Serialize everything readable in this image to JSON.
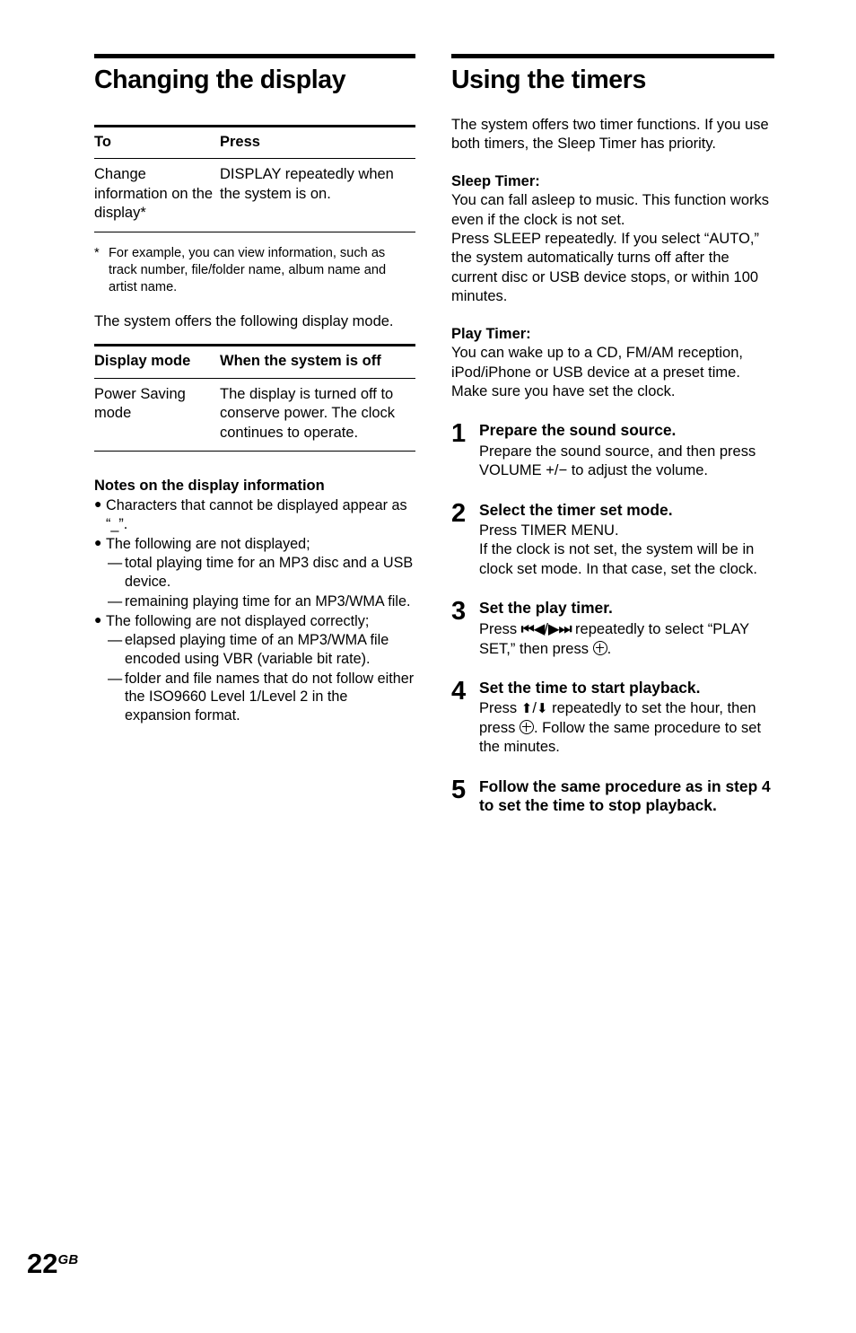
{
  "page": {
    "number": "22",
    "region_code": "GB"
  },
  "left_column": {
    "title": "Changing the display",
    "table1": {
      "headers": [
        "To",
        "Press"
      ],
      "rows": [
        {
          "to": "Change information on the display*",
          "press": "DISPLAY repeatedly when the system is on."
        }
      ]
    },
    "footnote": {
      "mark": "*",
      "text": "For example, you can view information, such as track number, file/folder name, album name and artist name."
    },
    "intro": "The system offers the following display mode.",
    "table2": {
      "headers": [
        "Display mode",
        "When the system is off"
      ],
      "rows": [
        {
          "mode": "Power Saving mode",
          "when_off": "The display is turned off to conserve power. The clock continues to operate."
        }
      ]
    },
    "notes": {
      "title": "Notes on the display information",
      "items": [
        {
          "text": "Characters that cannot be displayed appear as “_”.",
          "sub": []
        },
        {
          "text": "The following are not displayed;",
          "sub": [
            "total playing time for an MP3 disc and a USB device.",
            "remaining playing time for an MP3/WMA file."
          ]
        },
        {
          "text": "The following are not displayed correctly;",
          "sub": [
            "elapsed playing time of an MP3/WMA file encoded using VBR (variable bit rate).",
            "folder and file names that do not follow either the ISO9660 Level 1/Level 2 in the expansion format."
          ]
        }
      ]
    }
  },
  "right_column": {
    "title": "Using the timers",
    "intro": "The system offers two timer functions. If you use both timers, the Sleep Timer has priority.",
    "sleep_timer": {
      "heading": "Sleep Timer:",
      "text_1": "You can fall asleep to music. This function works even if the clock is not set.",
      "text_2": "Press SLEEP repeatedly. If you select “AUTO,” the system automatically turns off after the current disc or USB device stops, or within 100 minutes."
    },
    "play_timer": {
      "heading": "Play Timer:",
      "text_1": "You can wake up to a CD, FM/AM reception, iPod/iPhone or USB device at a preset time.",
      "text_2": "Make sure you have set the clock."
    },
    "steps": [
      {
        "number": "1",
        "title": "Prepare the sound source.",
        "text_a": "Prepare the sound source, and then press VOLUME +/− to adjust the volume.",
        "text_b": "",
        "text_c": ""
      },
      {
        "number": "2",
        "title": "Select the timer set mode.",
        "text_a": "Press TIMER MENU.",
        "text_b": "If the clock is not set, the system will be in clock set mode. In that case, set the clock.",
        "text_c": ""
      },
      {
        "number": "3",
        "title": "Set the play timer.",
        "text_a": "Press ",
        "text_b": " repeatedly to select “PLAY SET,” then press ",
        "text_c": ".",
        "glyph_prev": "⏮◀",
        "glyph_sep": "/",
        "glyph_next": "▶⏭"
      },
      {
        "number": "4",
        "title": "Set the time to start playback.",
        "text_a": "Press ",
        "text_b": " repeatedly to set the hour, then press ",
        "text_c": ". Follow the same procedure to set the minutes.",
        "glyph_up": "⬆",
        "glyph_sep": "/",
        "glyph_down": "⬇"
      },
      {
        "number": "5",
        "title": "Follow the same procedure as in step 4 to set the time to stop playback.",
        "text_a": "",
        "text_b": "",
        "text_c": ""
      }
    ]
  }
}
